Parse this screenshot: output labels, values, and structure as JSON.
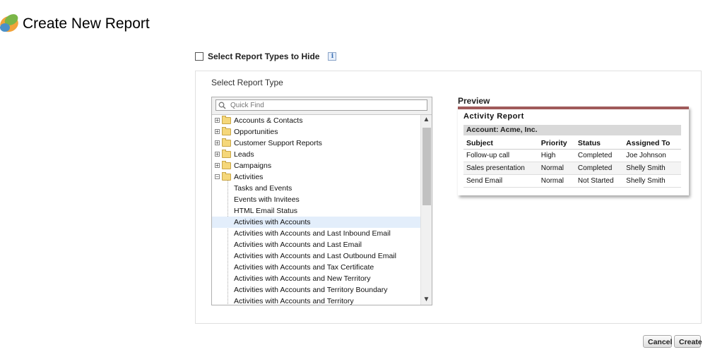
{
  "header": {
    "title": "Create New Report"
  },
  "hide_types": {
    "label": "Select Report Types to Hide",
    "info_glyph": "i"
  },
  "panel": {
    "label": "Select Report Type"
  },
  "quick_find": {
    "placeholder": "Quick Find"
  },
  "tree": {
    "folders": [
      {
        "label": "Accounts & Contacts",
        "expander": "+"
      },
      {
        "label": "Opportunities",
        "expander": "+"
      },
      {
        "label": "Customer Support Reports",
        "expander": "+"
      },
      {
        "label": "Leads",
        "expander": "+"
      },
      {
        "label": "Campaigns",
        "expander": "+"
      },
      {
        "label": "Activities",
        "expander": "−"
      }
    ],
    "children": [
      {
        "label": "Tasks and Events"
      },
      {
        "label": "Events with Invitees"
      },
      {
        "label": "HTML Email Status"
      },
      {
        "label": "Activities with Accounts"
      },
      {
        "label": "Activities with Accounts and Last Inbound Email"
      },
      {
        "label": "Activities with Accounts and Last Email"
      },
      {
        "label": "Activities with Accounts and Last Outbound Email"
      },
      {
        "label": "Activities with Accounts and Tax Certificate"
      },
      {
        "label": "Activities with Accounts and New Territory"
      },
      {
        "label": "Activities with Accounts and Territory Boundary"
      },
      {
        "label": "Activities with Accounts and Territory"
      }
    ],
    "selected": "Activities with Accounts"
  },
  "scrollbar": {
    "up": "▲",
    "down": "▼"
  },
  "preview": {
    "label": "Preview",
    "report_title": "Activity Report",
    "account": "Account: Acme, Inc.",
    "columns": [
      "Subject",
      "Priority",
      "Status",
      "Assigned To"
    ],
    "rows": [
      [
        "Follow-up call",
        "High",
        "Completed",
        "Joe Johnson"
      ],
      [
        "Sales presentation",
        "Normal",
        "Completed",
        "Shelly Smith"
      ],
      [
        "Send Email",
        "Normal",
        "Not Started",
        "Shelly Smith"
      ]
    ]
  },
  "buttons": {
    "cancel": "Cancel",
    "create": "Create"
  },
  "colors": {
    "preview_accent": "#a05a5a",
    "selected_row": "#e3eefb"
  }
}
